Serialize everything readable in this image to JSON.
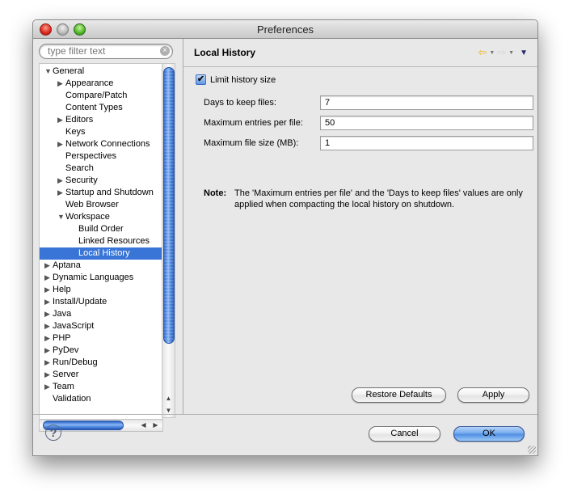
{
  "window": {
    "title": "Preferences"
  },
  "filter": {
    "placeholder": "type filter text"
  },
  "tree": {
    "items": [
      {
        "label": "General",
        "level": 0,
        "twisty": "open"
      },
      {
        "label": "Appearance",
        "level": 1,
        "twisty": "closed"
      },
      {
        "label": "Compare/Patch",
        "level": 1,
        "twisty": "none"
      },
      {
        "label": "Content Types",
        "level": 1,
        "twisty": "none"
      },
      {
        "label": "Editors",
        "level": 1,
        "twisty": "closed"
      },
      {
        "label": "Keys",
        "level": 1,
        "twisty": "none"
      },
      {
        "label": "Network Connections",
        "level": 1,
        "twisty": "closed"
      },
      {
        "label": "Perspectives",
        "level": 1,
        "twisty": "none"
      },
      {
        "label": "Search",
        "level": 1,
        "twisty": "none"
      },
      {
        "label": "Security",
        "level": 1,
        "twisty": "closed"
      },
      {
        "label": "Startup and Shutdown",
        "level": 1,
        "twisty": "closed"
      },
      {
        "label": "Web Browser",
        "level": 1,
        "twisty": "none"
      },
      {
        "label": "Workspace",
        "level": 1,
        "twisty": "open"
      },
      {
        "label": "Build Order",
        "level": 2,
        "twisty": "none"
      },
      {
        "label": "Linked Resources",
        "level": 2,
        "twisty": "none"
      },
      {
        "label": "Local History",
        "level": 2,
        "twisty": "none",
        "selected": true
      },
      {
        "label": "Aptana",
        "level": 0,
        "twisty": "closed"
      },
      {
        "label": "Dynamic Languages",
        "level": 0,
        "twisty": "closed"
      },
      {
        "label": "Help",
        "level": 0,
        "twisty": "closed"
      },
      {
        "label": "Install/Update",
        "level": 0,
        "twisty": "closed"
      },
      {
        "label": "Java",
        "level": 0,
        "twisty": "closed"
      },
      {
        "label": "JavaScript",
        "level": 0,
        "twisty": "closed"
      },
      {
        "label": "PHP",
        "level": 0,
        "twisty": "closed"
      },
      {
        "label": "PyDev",
        "level": 0,
        "twisty": "closed"
      },
      {
        "label": "Run/Debug",
        "level": 0,
        "twisty": "closed"
      },
      {
        "label": "Server",
        "level": 0,
        "twisty": "closed"
      },
      {
        "label": "Team",
        "level": 0,
        "twisty": "closed"
      },
      {
        "label": "Validation",
        "level": 0,
        "twisty": "none"
      }
    ]
  },
  "page": {
    "title": "Local History",
    "limit_checkbox": {
      "label": "Limit history size",
      "checked": true
    },
    "fields": [
      {
        "label": "Days to keep files:",
        "value": "7"
      },
      {
        "label": "Maximum entries per file:",
        "value": "50"
      },
      {
        "label": "Maximum file size (MB):",
        "value": "1"
      }
    ],
    "note_label": "Note:",
    "note_text": "The 'Maximum entries per file' and the 'Days to keep files' values are only applied when compacting the local history on shutdown.",
    "restore_defaults": "Restore Defaults",
    "apply": "Apply"
  },
  "footer": {
    "cancel": "Cancel",
    "ok": "OK",
    "help_glyph": "?"
  },
  "icons": {
    "back": "⇦",
    "forward": "⇨",
    "dropdown": "▼",
    "view_menu": "▼",
    "twisty_open": "▼",
    "twisty_closed": "▶",
    "check": "✔",
    "clear": "×",
    "up": "▲",
    "down": "▼",
    "left": "◀",
    "right": "▶"
  },
  "colors": {
    "selection": "#3875d7",
    "accent": "#5b94e6"
  }
}
